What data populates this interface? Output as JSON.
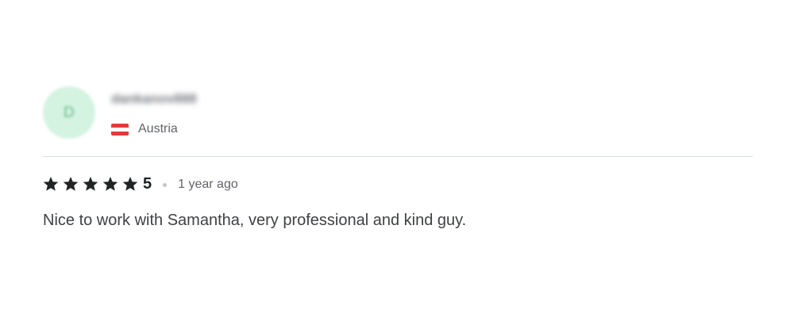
{
  "reviewer": {
    "avatar_letter": "D",
    "username": "dankanov888",
    "country": "Austria",
    "flag_colors": [
      "#e13a3e",
      "#ffffff",
      "#e13a3e"
    ]
  },
  "rating": {
    "stars": 5,
    "value": "5",
    "time_ago": "1 year ago",
    "star_color": "#222325"
  },
  "review": {
    "text": "Nice to work with Samantha, very professional and kind guy."
  }
}
